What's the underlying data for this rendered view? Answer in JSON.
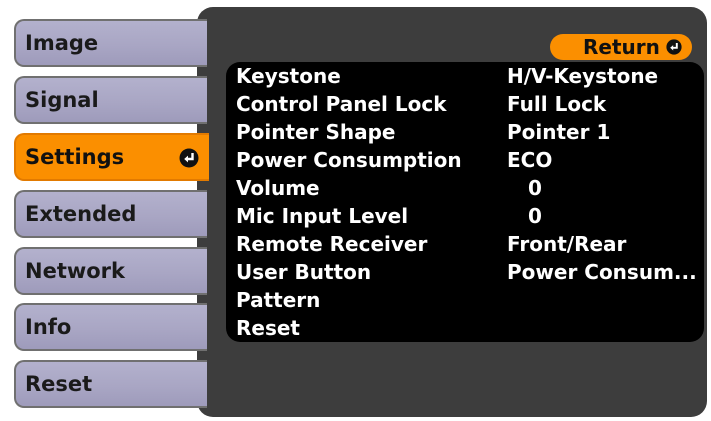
{
  "sidebar": {
    "items": [
      {
        "label": "Image"
      },
      {
        "label": "Signal"
      },
      {
        "label": "Settings"
      },
      {
        "label": "Extended"
      },
      {
        "label": "Network"
      },
      {
        "label": "Info"
      },
      {
        "label": "Reset"
      }
    ],
    "selected_index": 2,
    "selected_icon": "enter-icon"
  },
  "return_button": {
    "label": "Return",
    "icon": "enter-icon"
  },
  "menu": {
    "items": [
      {
        "label": "Keystone",
        "value": "H/V-Keystone"
      },
      {
        "label": "Control Panel Lock",
        "value": "Full Lock"
      },
      {
        "label": "Pointer Shape",
        "value": "Pointer 1"
      },
      {
        "label": "Power Consumption",
        "value": "ECO"
      },
      {
        "label": "Volume",
        "value": "0"
      },
      {
        "label": "Mic Input Level",
        "value": "0"
      },
      {
        "label": "Remote Receiver",
        "value": "Front/Rear"
      },
      {
        "label": "User Button",
        "value": "Power Consum..."
      },
      {
        "label": "Pattern",
        "value": ""
      },
      {
        "label": "Reset",
        "value": ""
      }
    ]
  },
  "colors": {
    "accent": "#fb8f00",
    "panel": "#3d3d3d",
    "menu_background": "#000000",
    "tab": "#a9a6c4",
    "text_light": "#ffffff"
  }
}
